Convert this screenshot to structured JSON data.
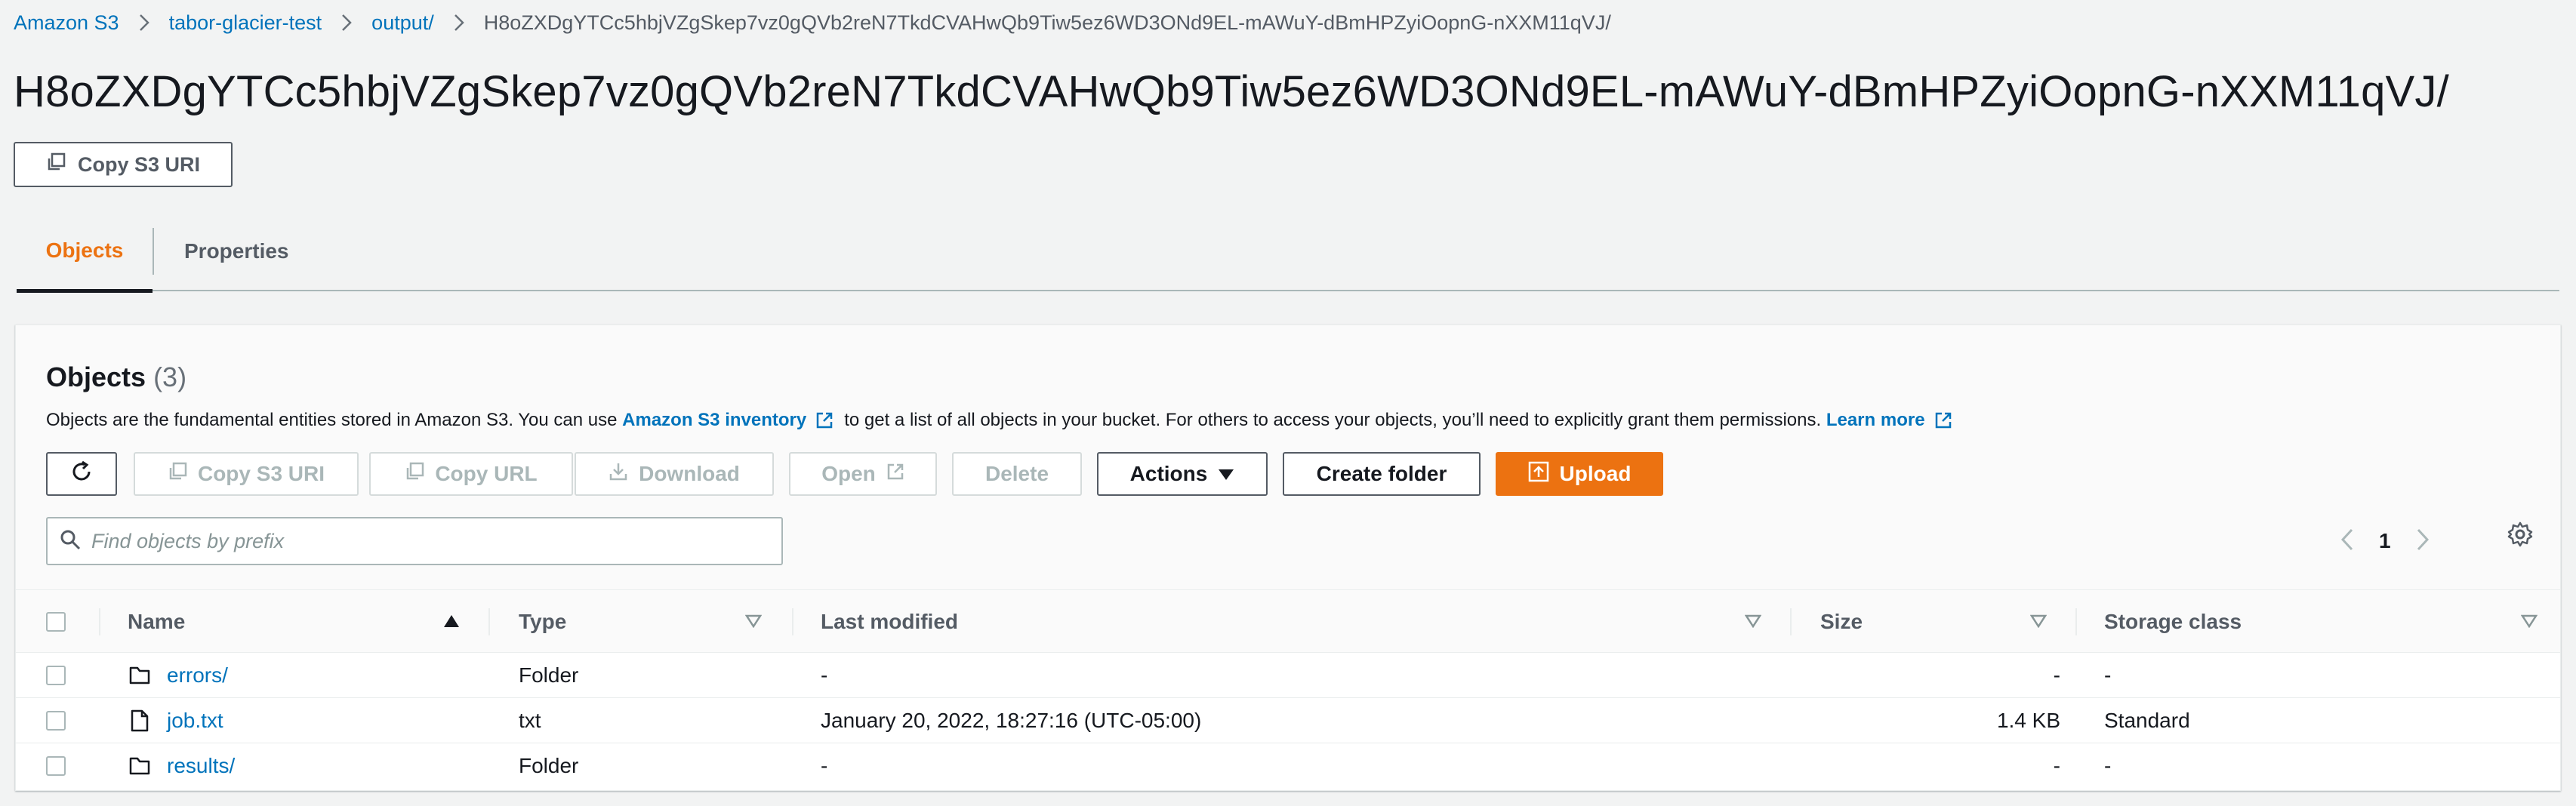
{
  "breadcrumb": {
    "items": [
      "Amazon S3",
      "tabor-glacier-test",
      "output/"
    ],
    "current": "H8oZXDgYTCc5hbjVZgSkep7vz0gQVb2reN7TkdCVAHwQb9Tiw5ez6WD3ONd9EL-mAWuY-dBmHPZyiOopnG-nXXM11qVJ/"
  },
  "page": {
    "title": "H8oZXDgYTCc5hbjVZgSkep7vz0gQVb2reN7TkdCVAHwQb9Tiw5ez6WD3ONd9EL-mAWuY-dBmHPZyiOopnG-nXXM11qVJ/",
    "copy_uri_label": "Copy S3 URI"
  },
  "tabs": [
    {
      "label": "Objects",
      "active": true
    },
    {
      "label": "Properties",
      "active": false
    }
  ],
  "objects_panel": {
    "title": "Objects",
    "count": "(3)",
    "desc_part1": "Objects are the fundamental entities stored in Amazon S3. You can use",
    "inventory_link": "Amazon S3 inventory",
    "desc_part2": "to get a list of all objects in your bucket. For others to access your objects, you’ll need to explicitly grant them permissions.",
    "learn_more": "Learn more",
    "buttons": {
      "copy_s3_uri": "Copy S3 URI",
      "copy_url": "Copy URL",
      "download": "Download",
      "open": "Open",
      "delete": "Delete",
      "actions": "Actions",
      "create_folder": "Create folder",
      "upload": "Upload"
    },
    "search_placeholder": "Find objects by prefix",
    "current_page": "1",
    "columns": [
      "Name",
      "Type",
      "Last modified",
      "Size",
      "Storage class"
    ],
    "rows": [
      {
        "name": "errors/",
        "type": "Folder",
        "last_modified": "-",
        "size": "-",
        "storage_class": "-",
        "icon": "folder-icon"
      },
      {
        "name": "job.txt",
        "type": "txt",
        "last_modified": "January 20, 2022, 18:27:16 (UTC-05:00)",
        "size": "1.4 KB",
        "storage_class": "Standard",
        "icon": "file-icon"
      },
      {
        "name": "results/",
        "type": "Folder",
        "last_modified": "-",
        "size": "-",
        "storage_class": "-",
        "icon": "folder-icon"
      }
    ]
  },
  "colors": {
    "link": "#0073bb",
    "primary": "#ec7211",
    "text": "#16191f",
    "muted": "#545b64",
    "disabled": "#aab7b8"
  }
}
